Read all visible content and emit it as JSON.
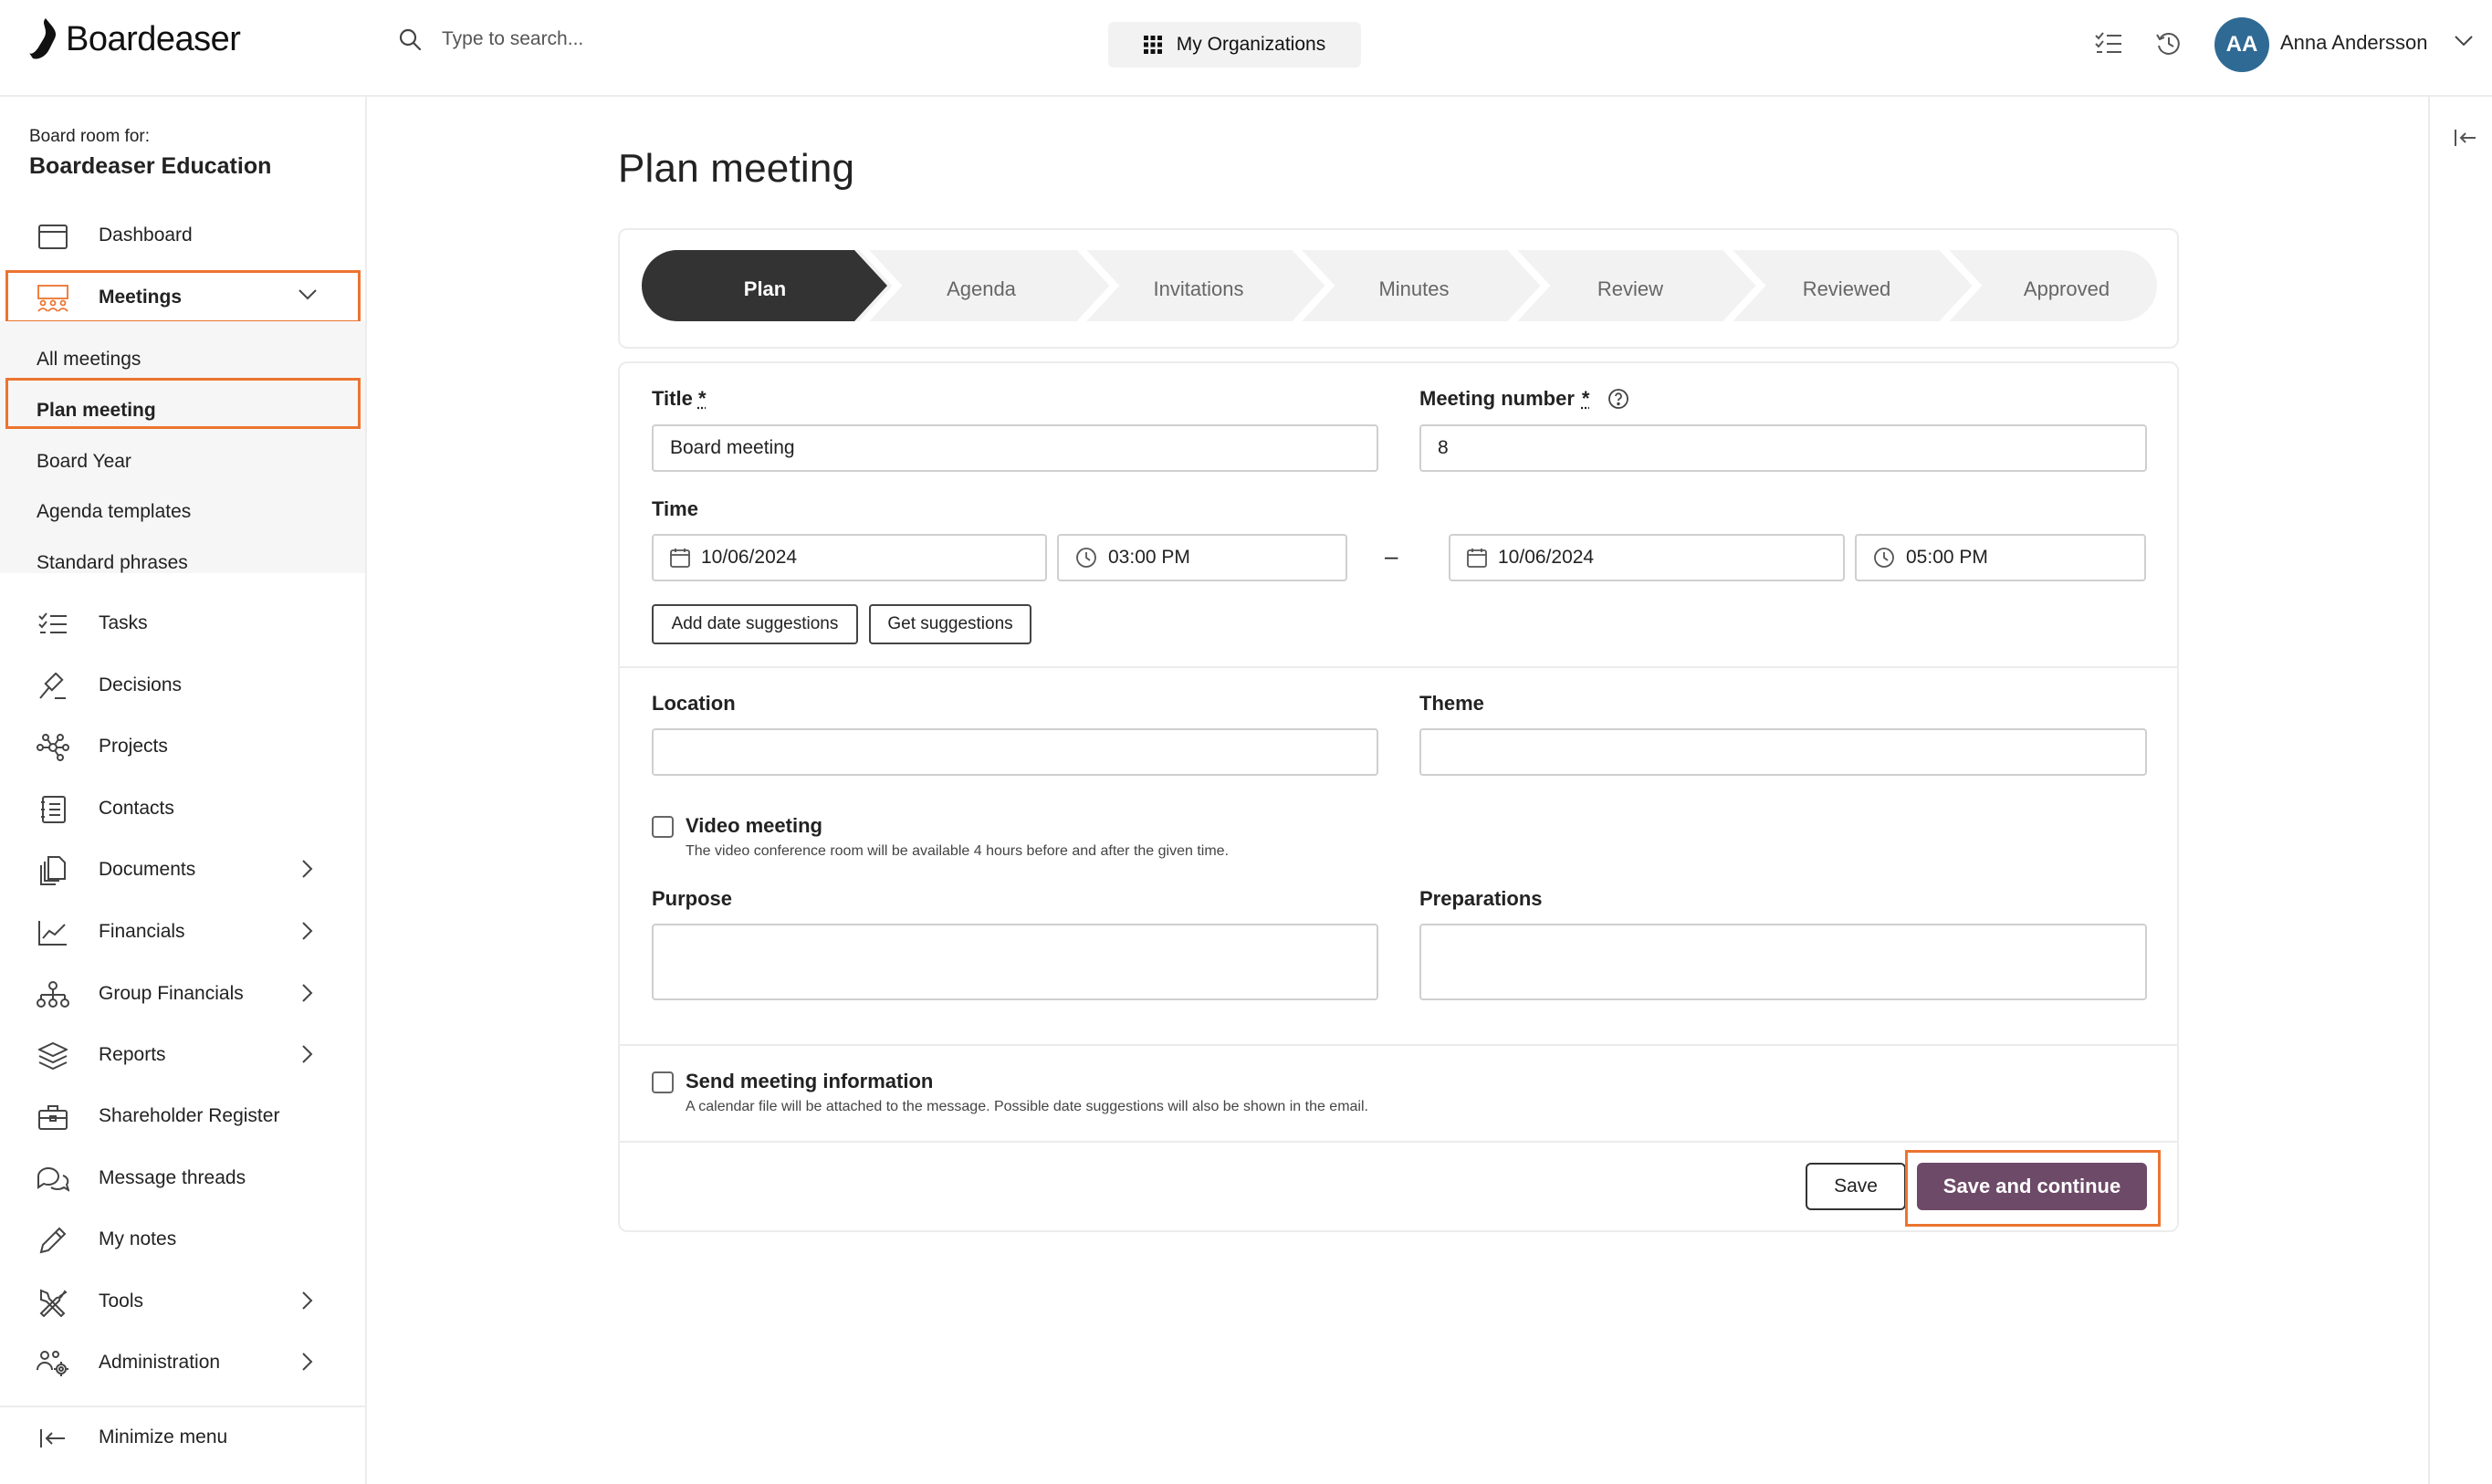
{
  "app": {
    "brand": "Boardeaser",
    "search_placeholder": "Type to search...",
    "org_button": "My Organizations",
    "user": {
      "initials": "AA",
      "name": "Anna Andersson"
    }
  },
  "sidebar": {
    "board_room_label": "Board room for:",
    "board_room_name": "Boardeaser Education",
    "items": [
      {
        "label": "Dashboard",
        "icon": "calendar-icon"
      },
      {
        "label": "Meetings",
        "icon": "meeting-icon",
        "expanded": true
      },
      {
        "label": "Tasks",
        "icon": "checklist-icon"
      },
      {
        "label": "Decisions",
        "icon": "gavel-icon"
      },
      {
        "label": "Projects",
        "icon": "network-icon"
      },
      {
        "label": "Contacts",
        "icon": "contacts-icon"
      },
      {
        "label": "Documents",
        "icon": "documents-icon"
      },
      {
        "label": "Financials",
        "icon": "line-chart-icon"
      },
      {
        "label": "Group Financials",
        "icon": "org-chart-icon"
      },
      {
        "label": "Reports",
        "icon": "layers-icon"
      },
      {
        "label": "Shareholder Register",
        "icon": "briefcase-icon"
      },
      {
        "label": "Message threads",
        "icon": "chat-icon"
      },
      {
        "label": "My notes",
        "icon": "pencil-icon"
      },
      {
        "label": "Tools",
        "icon": "tools-icon"
      },
      {
        "label": "Administration",
        "icon": "users-gear-icon"
      }
    ],
    "meetings_sub": [
      "All meetings",
      "Plan meeting",
      "Board Year",
      "Agenda templates",
      "Standard phrases"
    ],
    "minimize": "Minimize menu"
  },
  "page": {
    "title": "Plan meeting",
    "steps": [
      "Plan",
      "Agenda",
      "Invitations",
      "Minutes",
      "Review",
      "Reviewed",
      "Approved"
    ],
    "active_step": "Plan"
  },
  "form": {
    "title_label": "Title",
    "title_value": "Board meeting",
    "meeting_number_label": "Meeting number",
    "meeting_number_value": "8",
    "required_mark": "*",
    "time_label": "Time",
    "start_date": "10/06/2024",
    "start_time": "03:00 PM",
    "end_date": "10/06/2024",
    "end_time": "05:00 PM",
    "range_separator": "–",
    "add_date_suggestions": "Add date suggestions",
    "get_suggestions": "Get suggestions",
    "location_label": "Location",
    "location_value": "",
    "theme_label": "Theme",
    "theme_value": "",
    "video_meeting_label": "Video meeting",
    "video_meeting_help": "The video conference room will be available 4 hours before and after the given time.",
    "purpose_label": "Purpose",
    "preparations_label": "Preparations",
    "send_info_label": "Send meeting information",
    "send_info_help": "A calendar file will be attached to the message. Possible date suggestions will also be shown in the email.",
    "save": "Save",
    "save_continue": "Save and continue"
  },
  "colors": {
    "accent_primary": "#6d4a68",
    "active_step": "#333333",
    "highlight": "#ec7430",
    "avatar": "#2f6a94"
  }
}
